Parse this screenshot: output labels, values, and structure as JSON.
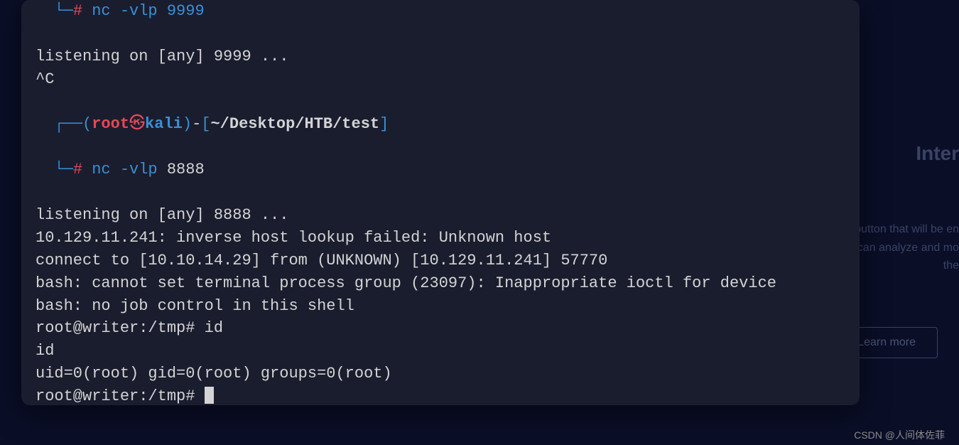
{
  "background": {
    "title": "Inter",
    "desc1": "A button that will be en",
    "desc2": "that you can analyze and mo",
    "desc3": "the",
    "btn": "Learn more"
  },
  "terminal": {
    "line1_cmd": "nc -vlp",
    "line1_port": "9999",
    "line2": "listening on [any] 9999 ...",
    "line3": "^C",
    "prompt_user": "root",
    "prompt_skull": "㉿",
    "prompt_host": "kali",
    "prompt_path": "~/Desktop/HTB/test",
    "line5_cmd": "nc -vlp",
    "line5_port": "8888",
    "line6": "listening on [any] 8888 ...",
    "line7": "10.129.11.241: inverse host lookup failed: Unknown host",
    "line8": "connect to [10.10.14.29] from (UNKNOWN) [10.129.11.241] 57770",
    "line9": "bash: cannot set terminal process group (23097): Inappropriate ioctl for device",
    "line10": "bash: no job control in this shell",
    "line11": "root@writer:/tmp# id",
    "line12": "id",
    "line13": "uid=0(root) gid=0(root) groups=0(root)",
    "line14": "root@writer:/tmp# "
  },
  "watermark": "CSDN @人间体佐菲"
}
